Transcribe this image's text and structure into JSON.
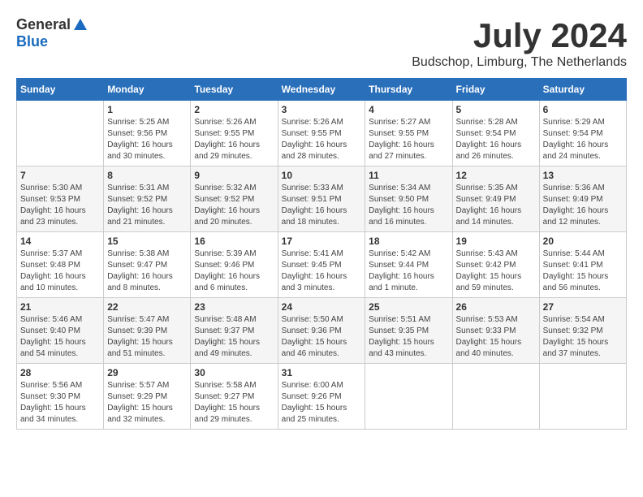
{
  "header": {
    "logo_general": "General",
    "logo_blue": "Blue",
    "title": "July 2024",
    "location": "Budschop, Limburg, The Netherlands"
  },
  "weekdays": [
    "Sunday",
    "Monday",
    "Tuesday",
    "Wednesday",
    "Thursday",
    "Friday",
    "Saturday"
  ],
  "weeks": [
    [
      {
        "day": "",
        "info": ""
      },
      {
        "day": "1",
        "info": "Sunrise: 5:25 AM\nSunset: 9:56 PM\nDaylight: 16 hours\nand 30 minutes."
      },
      {
        "day": "2",
        "info": "Sunrise: 5:26 AM\nSunset: 9:55 PM\nDaylight: 16 hours\nand 29 minutes."
      },
      {
        "day": "3",
        "info": "Sunrise: 5:26 AM\nSunset: 9:55 PM\nDaylight: 16 hours\nand 28 minutes."
      },
      {
        "day": "4",
        "info": "Sunrise: 5:27 AM\nSunset: 9:55 PM\nDaylight: 16 hours\nand 27 minutes."
      },
      {
        "day": "5",
        "info": "Sunrise: 5:28 AM\nSunset: 9:54 PM\nDaylight: 16 hours\nand 26 minutes."
      },
      {
        "day": "6",
        "info": "Sunrise: 5:29 AM\nSunset: 9:54 PM\nDaylight: 16 hours\nand 24 minutes."
      }
    ],
    [
      {
        "day": "7",
        "info": "Sunrise: 5:30 AM\nSunset: 9:53 PM\nDaylight: 16 hours\nand 23 minutes."
      },
      {
        "day": "8",
        "info": "Sunrise: 5:31 AM\nSunset: 9:52 PM\nDaylight: 16 hours\nand 21 minutes."
      },
      {
        "day": "9",
        "info": "Sunrise: 5:32 AM\nSunset: 9:52 PM\nDaylight: 16 hours\nand 20 minutes."
      },
      {
        "day": "10",
        "info": "Sunrise: 5:33 AM\nSunset: 9:51 PM\nDaylight: 16 hours\nand 18 minutes."
      },
      {
        "day": "11",
        "info": "Sunrise: 5:34 AM\nSunset: 9:50 PM\nDaylight: 16 hours\nand 16 minutes."
      },
      {
        "day": "12",
        "info": "Sunrise: 5:35 AM\nSunset: 9:49 PM\nDaylight: 16 hours\nand 14 minutes."
      },
      {
        "day": "13",
        "info": "Sunrise: 5:36 AM\nSunset: 9:49 PM\nDaylight: 16 hours\nand 12 minutes."
      }
    ],
    [
      {
        "day": "14",
        "info": "Sunrise: 5:37 AM\nSunset: 9:48 PM\nDaylight: 16 hours\nand 10 minutes."
      },
      {
        "day": "15",
        "info": "Sunrise: 5:38 AM\nSunset: 9:47 PM\nDaylight: 16 hours\nand 8 minutes."
      },
      {
        "day": "16",
        "info": "Sunrise: 5:39 AM\nSunset: 9:46 PM\nDaylight: 16 hours\nand 6 minutes."
      },
      {
        "day": "17",
        "info": "Sunrise: 5:41 AM\nSunset: 9:45 PM\nDaylight: 16 hours\nand 3 minutes."
      },
      {
        "day": "18",
        "info": "Sunrise: 5:42 AM\nSunset: 9:44 PM\nDaylight: 16 hours\nand 1 minute."
      },
      {
        "day": "19",
        "info": "Sunrise: 5:43 AM\nSunset: 9:42 PM\nDaylight: 15 hours\nand 59 minutes."
      },
      {
        "day": "20",
        "info": "Sunrise: 5:44 AM\nSunset: 9:41 PM\nDaylight: 15 hours\nand 56 minutes."
      }
    ],
    [
      {
        "day": "21",
        "info": "Sunrise: 5:46 AM\nSunset: 9:40 PM\nDaylight: 15 hours\nand 54 minutes."
      },
      {
        "day": "22",
        "info": "Sunrise: 5:47 AM\nSunset: 9:39 PM\nDaylight: 15 hours\nand 51 minutes."
      },
      {
        "day": "23",
        "info": "Sunrise: 5:48 AM\nSunset: 9:37 PM\nDaylight: 15 hours\nand 49 minutes."
      },
      {
        "day": "24",
        "info": "Sunrise: 5:50 AM\nSunset: 9:36 PM\nDaylight: 15 hours\nand 46 minutes."
      },
      {
        "day": "25",
        "info": "Sunrise: 5:51 AM\nSunset: 9:35 PM\nDaylight: 15 hours\nand 43 minutes."
      },
      {
        "day": "26",
        "info": "Sunrise: 5:53 AM\nSunset: 9:33 PM\nDaylight: 15 hours\nand 40 minutes."
      },
      {
        "day": "27",
        "info": "Sunrise: 5:54 AM\nSunset: 9:32 PM\nDaylight: 15 hours\nand 37 minutes."
      }
    ],
    [
      {
        "day": "28",
        "info": "Sunrise: 5:56 AM\nSunset: 9:30 PM\nDaylight: 15 hours\nand 34 minutes."
      },
      {
        "day": "29",
        "info": "Sunrise: 5:57 AM\nSunset: 9:29 PM\nDaylight: 15 hours\nand 32 minutes."
      },
      {
        "day": "30",
        "info": "Sunrise: 5:58 AM\nSunset: 9:27 PM\nDaylight: 15 hours\nand 29 minutes."
      },
      {
        "day": "31",
        "info": "Sunrise: 6:00 AM\nSunset: 9:26 PM\nDaylight: 15 hours\nand 25 minutes."
      },
      {
        "day": "",
        "info": ""
      },
      {
        "day": "",
        "info": ""
      },
      {
        "day": "",
        "info": ""
      }
    ]
  ]
}
